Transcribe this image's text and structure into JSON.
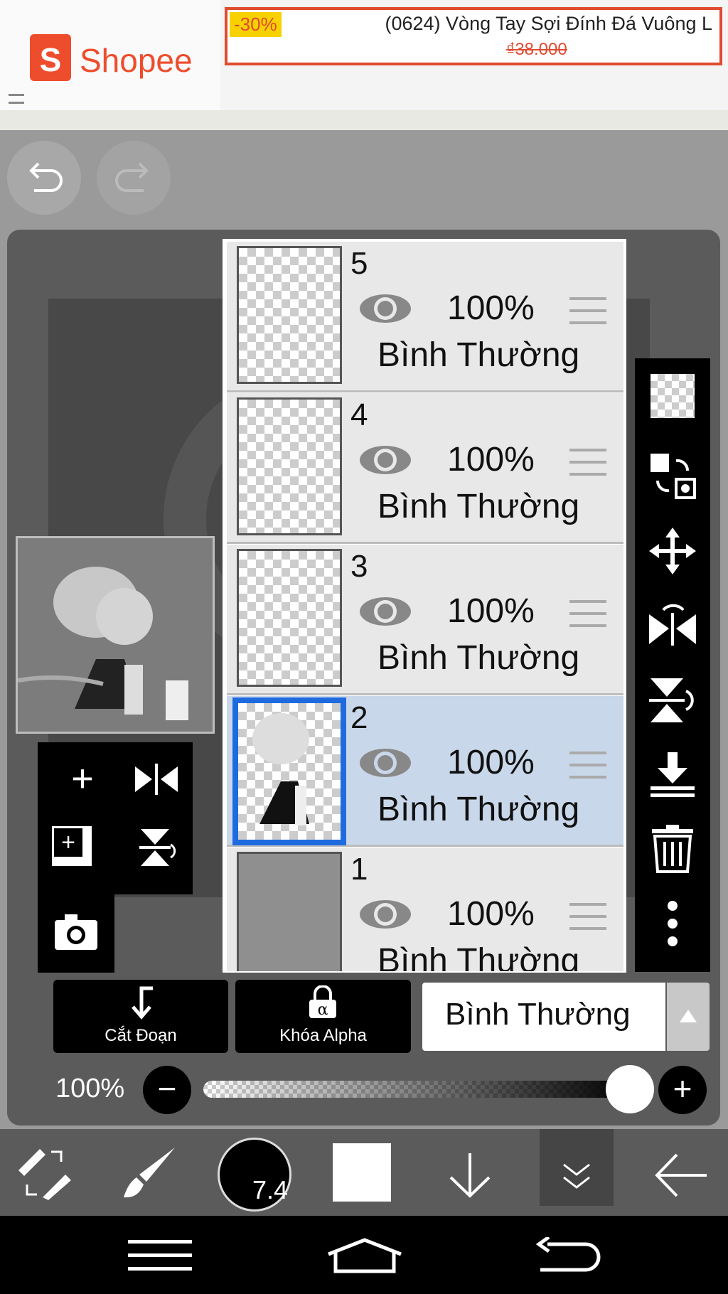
{
  "ad": {
    "brand": "Shopee",
    "brand_glyph": "S",
    "discount": "-30%",
    "title": "(0624) Vòng Tay Sợi Đính Đá Vuông L",
    "old_price": "₫38.000",
    "brand_color": "#ee4d2d"
  },
  "layers": [
    {
      "number": "5",
      "opacity": "100%",
      "mode": "Bình Thường",
      "selected": false
    },
    {
      "number": "4",
      "opacity": "100%",
      "mode": "Bình Thường",
      "selected": false
    },
    {
      "number": "3",
      "opacity": "100%",
      "mode": "Bình Thường",
      "selected": false
    },
    {
      "number": "2",
      "opacity": "100%",
      "mode": "Bình Thường",
      "selected": true
    },
    {
      "number": "1",
      "opacity": "100%",
      "mode": "Bình Thường",
      "selected": false
    }
  ],
  "blend": {
    "clip_label": "Cắt Đoạn",
    "alpha_label": "Khóa Alpha",
    "alpha_glyph": "α",
    "mode": "Bình Thường"
  },
  "opacity": {
    "label": "100%",
    "minus": "−",
    "plus": "+",
    "value": 1.0
  },
  "tools": {
    "brush_size": "7.4",
    "color": "#ffffff"
  },
  "left_tools": {
    "add": "+",
    "copy": "+"
  },
  "accent_color": "#1e6be0"
}
